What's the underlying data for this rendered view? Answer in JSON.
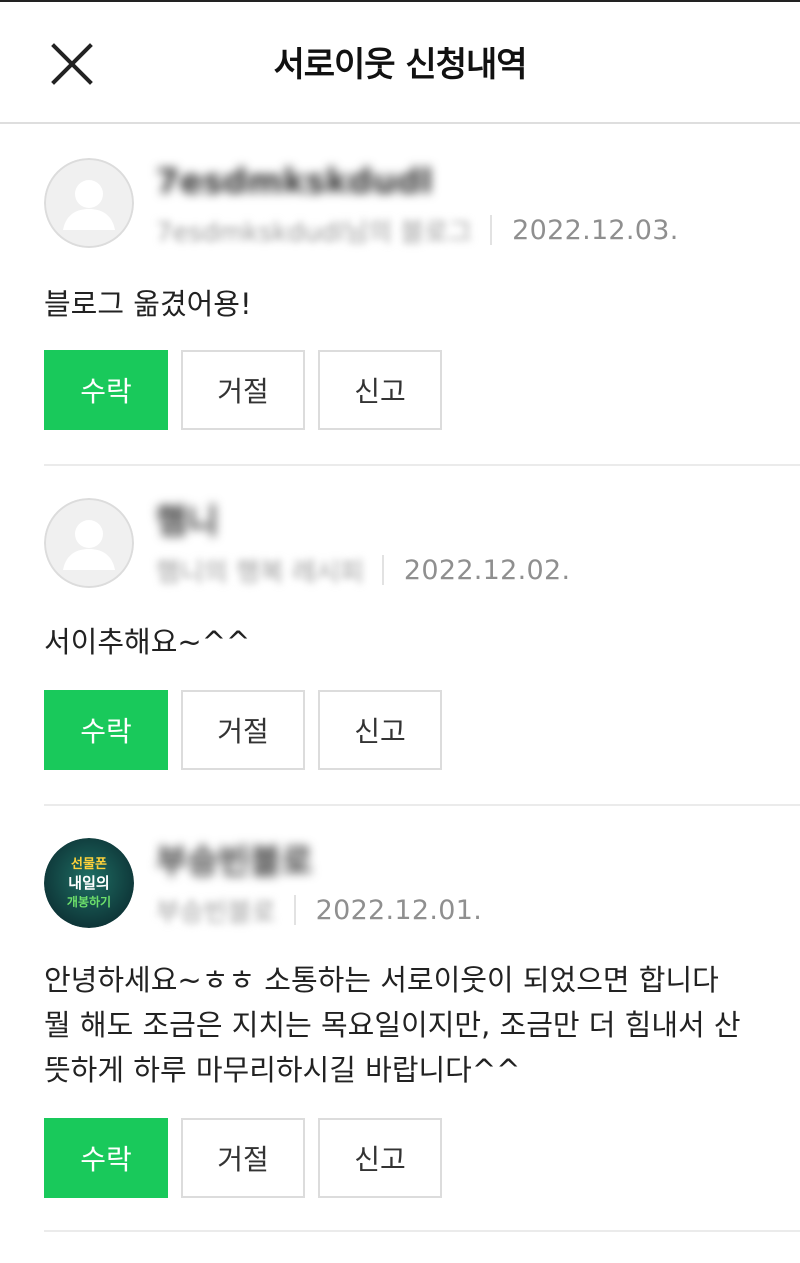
{
  "header": {
    "title": "서로이웃 신청내역",
    "close_icon": "close-icon"
  },
  "colors": {
    "accept": "#19c95b",
    "divider": "#ebebeb",
    "date": "#8f8f8f"
  },
  "requests": [
    {
      "name": "7esdmkskdudl",
      "blog": "7esdmkskdudl님의 블로그",
      "date": "2022.12.03.",
      "message": "블로그 옮겼어용!",
      "avatar_icon": "default-avatar-icon",
      "accept_label": "수락",
      "reject_label": "거절",
      "report_label": "신고"
    },
    {
      "name": "햄니",
      "blog": "햄니의 행복 레시피",
      "date": "2022.12.02.",
      "message": "서이추해요~^^",
      "avatar_icon": "default-avatar-icon",
      "accept_label": "수락",
      "reject_label": "거절",
      "report_label": "신고"
    },
    {
      "name": "부승빈블로",
      "blog": "부승빈블로",
      "date": "2022.12.01.",
      "message": "안녕하세요~ㅎㅎ 소통하는 서로이웃이 되었으면 합니다\n뭘 해도 조금은 지치는 목요일이지만, 조금만 더 힘내서 산\n뜻하게 하루 마무리하시길 바랍니다^^",
      "avatar_icon": "profile-image-icon",
      "avatar_text": [
        "선물폰",
        "내일의",
        "개봉하기"
      ],
      "accept_label": "수락",
      "reject_label": "거절",
      "report_label": "신고"
    }
  ]
}
